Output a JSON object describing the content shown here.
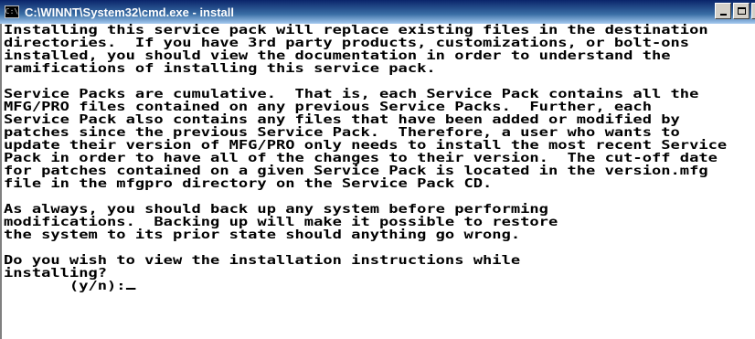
{
  "window": {
    "title": "C:\\WINNT\\System32\\cmd.exe - install",
    "icon": "console-icon",
    "icon_glyph": "C:\\",
    "controls": [
      "minimize",
      "maximize",
      "close"
    ],
    "close_glyph": "×"
  },
  "console": {
    "lines": [
      "Installing this service pack will replace existing files in the destination",
      "directories.  If you have 3rd party products, customizations, or bolt-ons",
      "installed, you should view the documentation in order to understand the",
      "ramifications of installing this service pack.",
      "",
      "Service Packs are cumulative.  That is, each Service Pack contains all the",
      "MFG/PRO files contained on any previous Service Packs.  Further, each",
      "Service Pack also contains any files that have been added or modified by",
      "patches since the previous Service Pack.  Therefore, a user who wants to",
      "update their version of MFG/PRO only needs to install the most recent Service",
      "Pack in order to have all of the changes to their version.  The cut-off date",
      "for patches contained on a given Service Pack is located in the version.mfg",
      "file in the mfgpro directory on the Service Pack CD.",
      "",
      "As always, you should back up any system before performing",
      "modifications.  Backing up will make it possible to restore",
      "the system to its prior state should anything go wrong.",
      "",
      "Do you wish to view the installation instructions while",
      "installing?"
    ],
    "prompt": "       (y/n):"
  }
}
